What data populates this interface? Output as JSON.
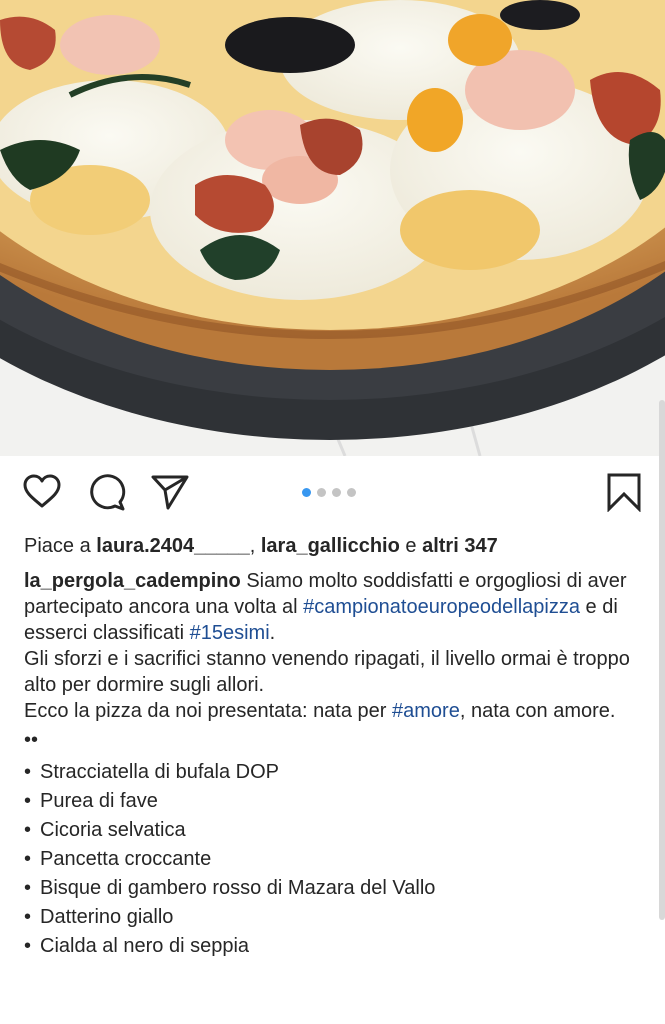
{
  "post": {
    "image": {
      "alt_name": "pizza-photo"
    },
    "carousel": {
      "count": 4,
      "active_index": 0
    },
    "icons": {
      "like": "heart-icon",
      "comment": "comment-bubble-icon",
      "share": "paper-plane-icon",
      "save": "bookmark-icon"
    },
    "likes": {
      "prefix": "Piace a",
      "user1": "laura.2404_____",
      "separator": ",",
      "user2": "lara_gallicchio",
      "conjunction": "e",
      "others": "altri 347"
    },
    "caption": {
      "username": "la_pergola_cadempino",
      "text1": "Siamo molto soddisfatti e orgogliosi di aver partecipato ancora una volta al",
      "hashtag1": "#campionatoeuropeodellapizza",
      "text2": "e di esserci classificati",
      "hashtag2": "#15esimi",
      "text3": ".",
      "paragraph2": "Gli sforzi e i sacrifici stanno venendo ripagati, il livello ormai è troppo alto per dormire sugli allori.",
      "paragraph3_a": "Ecco la pizza da noi presentata: nata per",
      "hashtag3": "#amore",
      "paragraph3_b": ", nata con amore.",
      "separator": "••",
      "ingredients": [
        "Stracciatella di bufala DOP",
        "Purea di fave",
        "Cicoria selvatica",
        "Pancetta croccante",
        "Bisque di gambero rosso di Mazara del Vallo",
        "Datterino giallo",
        "Cialda al nero di seppia"
      ],
      "bullet": "•"
    }
  },
  "colors": {
    "text": "#262626",
    "hashtag": "#1f4e93",
    "dot_active": "#3897f0",
    "dot_inactive": "#c4c4c4"
  }
}
